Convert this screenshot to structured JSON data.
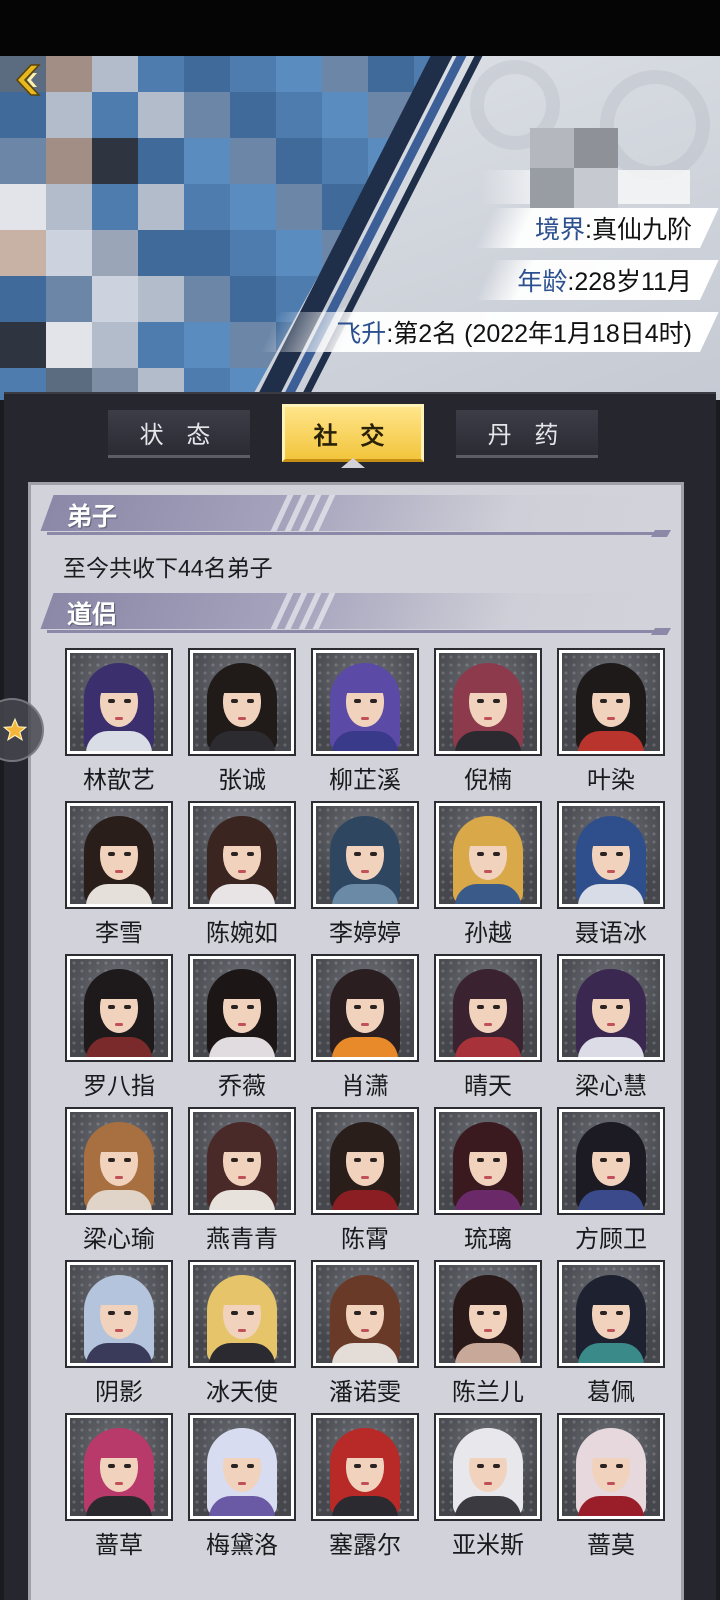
{
  "header": {
    "realm_label": "境界",
    "realm_value": "真仙九阶",
    "age_label": "年龄",
    "age_value": "228岁11月",
    "ascension_label": "飞升",
    "ascension_value": "第2名 (2022年1月18日4时)"
  },
  "tabs": [
    {
      "label": "状 态",
      "active": false
    },
    {
      "label": "社 交",
      "active": true
    },
    {
      "label": "丹 药",
      "active": false
    }
  ],
  "disciples": {
    "title": "弟子",
    "summary": "至今共收下44名弟子"
  },
  "partners": {
    "title": "道侣",
    "characters": [
      {
        "name": "林歆艺",
        "hair": "#3b2f6e",
        "outfit": "#d9dde6"
      },
      {
        "name": "张诚",
        "hair": "#201a18",
        "outfit": "#2b2b30"
      },
      {
        "name": "柳芷溪",
        "hair": "#5b4aa6",
        "outfit": "#3a3a8a"
      },
      {
        "name": "倪楠",
        "hair": "#8c3a4c",
        "outfit": "#2a2a30"
      },
      {
        "name": "叶染",
        "hair": "#1e1a1a",
        "outfit": "#b8342c"
      },
      {
        "name": "李雪",
        "hair": "#2a1e1a",
        "outfit": "#e6e0da"
      },
      {
        "name": "陈婉如",
        "hair": "#3a2520",
        "outfit": "#e8e4e6"
      },
      {
        "name": "李婷婷",
        "hair": "#2e4660",
        "outfit": "#6a8aa6"
      },
      {
        "name": "孙越",
        "hair": "#d9a848",
        "outfit": "#3a5a8a"
      },
      {
        "name": "聂语冰",
        "hair": "#2f4e8c",
        "outfit": "#d8dce6"
      },
      {
        "name": "罗八指",
        "hair": "#1e1a1c",
        "outfit": "#7a2a2a"
      },
      {
        "name": "乔薇",
        "hair": "#1c1616",
        "outfit": "#e0dce0"
      },
      {
        "name": "肖潇",
        "hair": "#2a1e20",
        "outfit": "#e88a2a"
      },
      {
        "name": "晴天",
        "hair": "#3a2230",
        "outfit": "#a8323a"
      },
      {
        "name": "梁心慧",
        "hair": "#3a2850",
        "outfit": "#dcdce6"
      },
      {
        "name": "梁心瑜",
        "hair": "#a87040",
        "outfit": "#e0d4c8"
      },
      {
        "name": "燕青青",
        "hair": "#4a2a28",
        "outfit": "#e8e2dc"
      },
      {
        "name": "陈霄",
        "hair": "#2a1e1a",
        "outfit": "#8a1e22"
      },
      {
        "name": "琉璃",
        "hair": "#3a1a1e",
        "outfit": "#6a2a6a"
      },
      {
        "name": "方顾卫",
        "hair": "#1c1a22",
        "outfit": "#3a4a8a"
      },
      {
        "name": "阴影",
        "hair": "#b4c4dc",
        "outfit": "#3a3a5a"
      },
      {
        "name": "冰天使",
        "hair": "#e6c56a",
        "outfit": "#2a2a30"
      },
      {
        "name": "潘诺雯",
        "hair": "#6a3a28",
        "outfit": "#e4dcd6"
      },
      {
        "name": "陈兰儿",
        "hair": "#2a1a1a",
        "outfit": "#c8a898"
      },
      {
        "name": "葛佩",
        "hair": "#1e2230",
        "outfit": "#3a8a8a"
      },
      {
        "name": "蔷草",
        "hair": "#b83a6a",
        "outfit": "#2a2a2e"
      },
      {
        "name": "梅黛洛",
        "hair": "#d8dcf0",
        "outfit": "#6a5aa6"
      },
      {
        "name": "塞露尔",
        "hair": "#b82a28",
        "outfit": "#2a2a30"
      },
      {
        "name": "亚米斯",
        "hair": "#e8e8ec",
        "outfit": "#3a3a40"
      },
      {
        "name": "蔷莫",
        "hair": "#e6d8dc",
        "outfit": "#9a1e2a"
      }
    ]
  },
  "colors": {
    "accent_gold": "#f2c53c",
    "panel_dark": "#26262e",
    "content_bg": "#d2d3da",
    "section_purple": "#8b88a8",
    "info_key_blue": "#2b4f8f"
  }
}
